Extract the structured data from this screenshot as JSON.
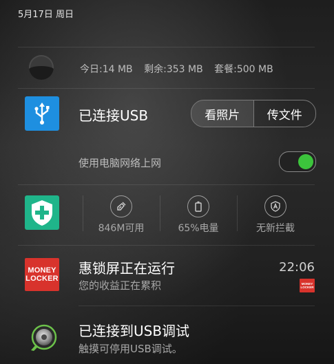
{
  "status": {
    "date": "5月17日 周日"
  },
  "data_usage": {
    "today": "今日:14 MB",
    "remaining": "剩余:353 MB",
    "plan": "套餐:500 MB"
  },
  "usb_notification": {
    "title": "已连接USB",
    "view_photos_label": "看照片",
    "transfer_files_label": "传文件",
    "tether_label": "使用电脑网络上网",
    "tether_enabled": true
  },
  "security": {
    "stats": [
      {
        "label": "846M可用",
        "icon": "broom-icon"
      },
      {
        "label": "65%电量",
        "icon": "battery-icon"
      },
      {
        "label": "无新拦截",
        "icon": "shield-a-icon"
      }
    ]
  },
  "money_locker": {
    "logo_line1": "MONEY",
    "logo_line2": "LOCKER",
    "title": "惠锁屏正在运行",
    "subtitle": "您的收益正在累积",
    "time": "22:06"
  },
  "usb_debug": {
    "title": "已连接到USB调试",
    "subtitle": "触摸可停用USB调试。"
  },
  "colors": {
    "usb_blue": "#1e8fe0",
    "security_green": "#1fb58a",
    "money_red": "#d8332c",
    "toggle_on": "#3cc43c"
  }
}
